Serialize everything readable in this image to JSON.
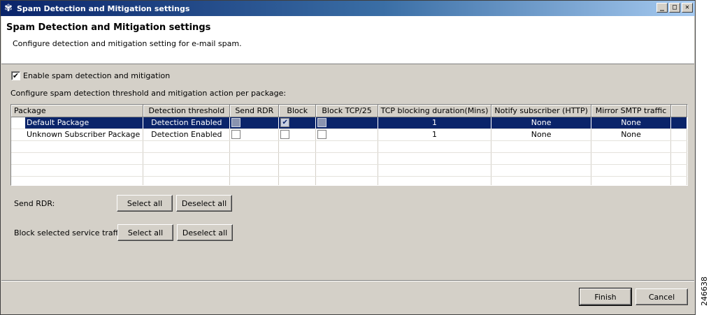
{
  "window": {
    "title": "Spam Detection and Mitigation settings",
    "controls": {
      "minimize": "_",
      "maximize": "□",
      "close": "✕"
    }
  },
  "header": {
    "title": "Spam Detection and Mitigation settings",
    "description": "Configure detection and mitigation setting for e-mail spam."
  },
  "enable": {
    "label": "Enable spam detection and mitigation",
    "checked": true
  },
  "configure_label": "Configure spam detection threshold and mitigation action per package:",
  "table": {
    "columns": [
      "Package",
      "Detection threshold",
      "Send RDR",
      "Block",
      "Block TCP/25",
      "TCP blocking duration(Mins)",
      "Notify subscriber (HTTP)",
      "Mirror SMTP traffic"
    ],
    "rows": [
      {
        "package": "Default Package",
        "threshold": "Detection Enabled",
        "send_rdr": false,
        "block": true,
        "block_tcp25": false,
        "duration": "1",
        "notify": "None",
        "mirror": "None",
        "selected": true
      },
      {
        "package": "Unknown Subscriber Package",
        "threshold": "Detection Enabled",
        "send_rdr": false,
        "block": false,
        "block_tcp25": false,
        "duration": "1",
        "notify": "None",
        "mirror": "None",
        "selected": false
      }
    ]
  },
  "send_rdr": {
    "label": "Send RDR:",
    "select_all": "Select all",
    "deselect_all": "Deselect all"
  },
  "block_traffic": {
    "label": "Block selected service traffic:",
    "select_all": "Select all",
    "deselect_all": "Deselect all"
  },
  "footer": {
    "finish": "Finish",
    "cancel": "Cancel"
  },
  "figure_ref": "246638"
}
